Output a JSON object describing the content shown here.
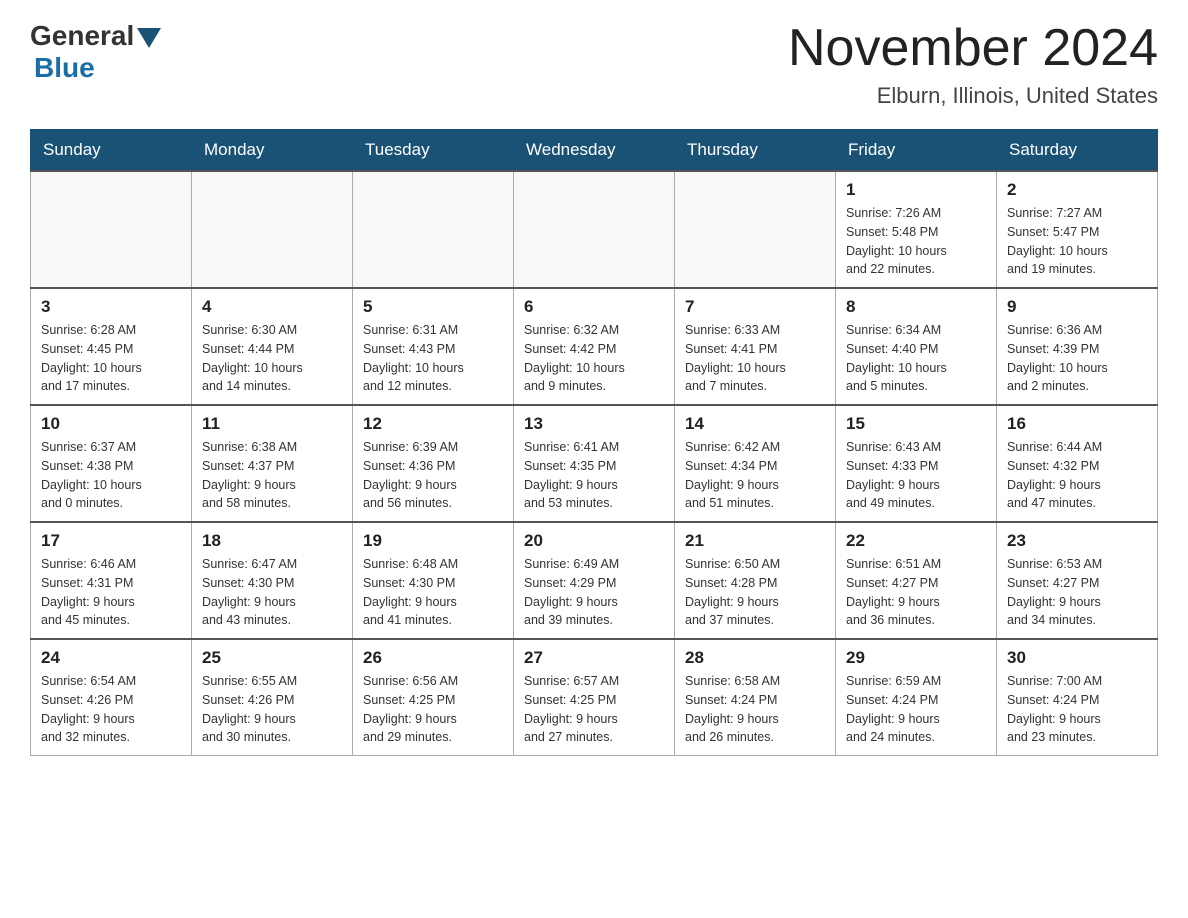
{
  "header": {
    "logo_general": "General",
    "logo_blue": "Blue",
    "month_title": "November 2024",
    "location": "Elburn, Illinois, United States"
  },
  "calendar": {
    "days_of_week": [
      "Sunday",
      "Monday",
      "Tuesday",
      "Wednesday",
      "Thursday",
      "Friday",
      "Saturday"
    ],
    "weeks": [
      [
        {
          "day": "",
          "info": []
        },
        {
          "day": "",
          "info": []
        },
        {
          "day": "",
          "info": []
        },
        {
          "day": "",
          "info": []
        },
        {
          "day": "",
          "info": []
        },
        {
          "day": "1",
          "info": [
            "Sunrise: 7:26 AM",
            "Sunset: 5:48 PM",
            "Daylight: 10 hours",
            "and 22 minutes."
          ]
        },
        {
          "day": "2",
          "info": [
            "Sunrise: 7:27 AM",
            "Sunset: 5:47 PM",
            "Daylight: 10 hours",
            "and 19 minutes."
          ]
        }
      ],
      [
        {
          "day": "3",
          "info": [
            "Sunrise: 6:28 AM",
            "Sunset: 4:45 PM",
            "Daylight: 10 hours",
            "and 17 minutes."
          ]
        },
        {
          "day": "4",
          "info": [
            "Sunrise: 6:30 AM",
            "Sunset: 4:44 PM",
            "Daylight: 10 hours",
            "and 14 minutes."
          ]
        },
        {
          "day": "5",
          "info": [
            "Sunrise: 6:31 AM",
            "Sunset: 4:43 PM",
            "Daylight: 10 hours",
            "and 12 minutes."
          ]
        },
        {
          "day": "6",
          "info": [
            "Sunrise: 6:32 AM",
            "Sunset: 4:42 PM",
            "Daylight: 10 hours",
            "and 9 minutes."
          ]
        },
        {
          "day": "7",
          "info": [
            "Sunrise: 6:33 AM",
            "Sunset: 4:41 PM",
            "Daylight: 10 hours",
            "and 7 minutes."
          ]
        },
        {
          "day": "8",
          "info": [
            "Sunrise: 6:34 AM",
            "Sunset: 4:40 PM",
            "Daylight: 10 hours",
            "and 5 minutes."
          ]
        },
        {
          "day": "9",
          "info": [
            "Sunrise: 6:36 AM",
            "Sunset: 4:39 PM",
            "Daylight: 10 hours",
            "and 2 minutes."
          ]
        }
      ],
      [
        {
          "day": "10",
          "info": [
            "Sunrise: 6:37 AM",
            "Sunset: 4:38 PM",
            "Daylight: 10 hours",
            "and 0 minutes."
          ]
        },
        {
          "day": "11",
          "info": [
            "Sunrise: 6:38 AM",
            "Sunset: 4:37 PM",
            "Daylight: 9 hours",
            "and 58 minutes."
          ]
        },
        {
          "day": "12",
          "info": [
            "Sunrise: 6:39 AM",
            "Sunset: 4:36 PM",
            "Daylight: 9 hours",
            "and 56 minutes."
          ]
        },
        {
          "day": "13",
          "info": [
            "Sunrise: 6:41 AM",
            "Sunset: 4:35 PM",
            "Daylight: 9 hours",
            "and 53 minutes."
          ]
        },
        {
          "day": "14",
          "info": [
            "Sunrise: 6:42 AM",
            "Sunset: 4:34 PM",
            "Daylight: 9 hours",
            "and 51 minutes."
          ]
        },
        {
          "day": "15",
          "info": [
            "Sunrise: 6:43 AM",
            "Sunset: 4:33 PM",
            "Daylight: 9 hours",
            "and 49 minutes."
          ]
        },
        {
          "day": "16",
          "info": [
            "Sunrise: 6:44 AM",
            "Sunset: 4:32 PM",
            "Daylight: 9 hours",
            "and 47 minutes."
          ]
        }
      ],
      [
        {
          "day": "17",
          "info": [
            "Sunrise: 6:46 AM",
            "Sunset: 4:31 PM",
            "Daylight: 9 hours",
            "and 45 minutes."
          ]
        },
        {
          "day": "18",
          "info": [
            "Sunrise: 6:47 AM",
            "Sunset: 4:30 PM",
            "Daylight: 9 hours",
            "and 43 minutes."
          ]
        },
        {
          "day": "19",
          "info": [
            "Sunrise: 6:48 AM",
            "Sunset: 4:30 PM",
            "Daylight: 9 hours",
            "and 41 minutes."
          ]
        },
        {
          "day": "20",
          "info": [
            "Sunrise: 6:49 AM",
            "Sunset: 4:29 PM",
            "Daylight: 9 hours",
            "and 39 minutes."
          ]
        },
        {
          "day": "21",
          "info": [
            "Sunrise: 6:50 AM",
            "Sunset: 4:28 PM",
            "Daylight: 9 hours",
            "and 37 minutes."
          ]
        },
        {
          "day": "22",
          "info": [
            "Sunrise: 6:51 AM",
            "Sunset: 4:27 PM",
            "Daylight: 9 hours",
            "and 36 minutes."
          ]
        },
        {
          "day": "23",
          "info": [
            "Sunrise: 6:53 AM",
            "Sunset: 4:27 PM",
            "Daylight: 9 hours",
            "and 34 minutes."
          ]
        }
      ],
      [
        {
          "day": "24",
          "info": [
            "Sunrise: 6:54 AM",
            "Sunset: 4:26 PM",
            "Daylight: 9 hours",
            "and 32 minutes."
          ]
        },
        {
          "day": "25",
          "info": [
            "Sunrise: 6:55 AM",
            "Sunset: 4:26 PM",
            "Daylight: 9 hours",
            "and 30 minutes."
          ]
        },
        {
          "day": "26",
          "info": [
            "Sunrise: 6:56 AM",
            "Sunset: 4:25 PM",
            "Daylight: 9 hours",
            "and 29 minutes."
          ]
        },
        {
          "day": "27",
          "info": [
            "Sunrise: 6:57 AM",
            "Sunset: 4:25 PM",
            "Daylight: 9 hours",
            "and 27 minutes."
          ]
        },
        {
          "day": "28",
          "info": [
            "Sunrise: 6:58 AM",
            "Sunset: 4:24 PM",
            "Daylight: 9 hours",
            "and 26 minutes."
          ]
        },
        {
          "day": "29",
          "info": [
            "Sunrise: 6:59 AM",
            "Sunset: 4:24 PM",
            "Daylight: 9 hours",
            "and 24 minutes."
          ]
        },
        {
          "day": "30",
          "info": [
            "Sunrise: 7:00 AM",
            "Sunset: 4:24 PM",
            "Daylight: 9 hours",
            "and 23 minutes."
          ]
        }
      ]
    ]
  }
}
